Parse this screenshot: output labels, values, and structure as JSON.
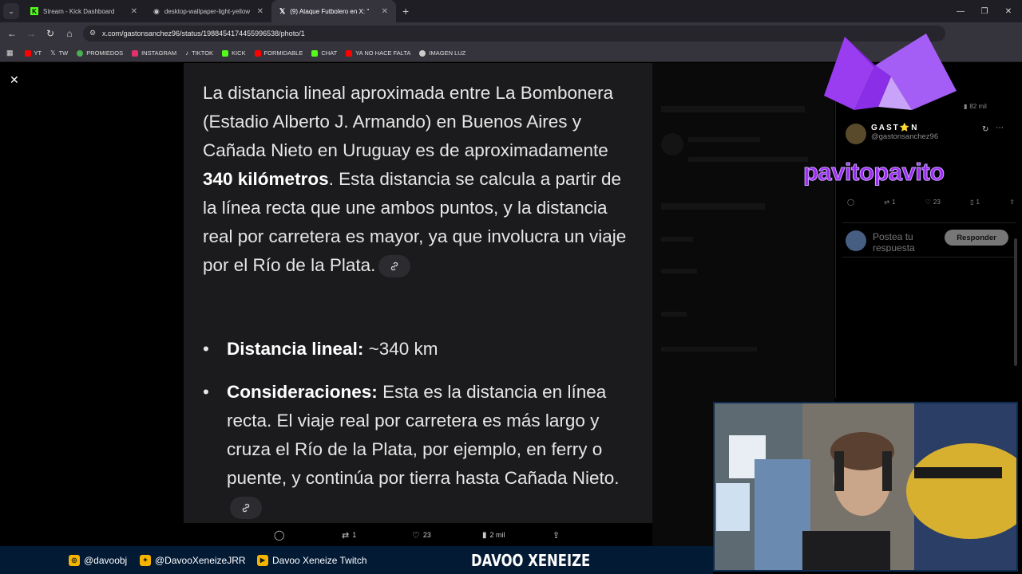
{
  "browser": {
    "tabs": [
      {
        "label": "Stream - Kick Dashboard",
        "icon": "kick-icon"
      },
      {
        "label": "desktop-wallpaper-light-yellow",
        "icon": "globe-icon"
      },
      {
        "label": "(9) Ataque Futbolero en X: \"",
        "icon": "x-icon",
        "active": true
      }
    ],
    "url": "x.com/gastonsanchez96/status/1988454174455996538/photo/1",
    "bookmarks": [
      {
        "label": "YT",
        "color": "#ff0000"
      },
      {
        "label": "TW",
        "color": "#ffffff"
      },
      {
        "label": "PROMIEDOS",
        "color": "#4caf50"
      },
      {
        "label": "INSTAGRAM",
        "color": "#e1306c"
      },
      {
        "label": "TIKTOK",
        "color": "#ffffff"
      },
      {
        "label": "KICK",
        "color": "#53fc18"
      },
      {
        "label": "FORMIDABLE",
        "color": "#ff0000"
      },
      {
        "label": "CHAT",
        "color": "#53fc18"
      },
      {
        "label": "YA NO HACE FALTA",
        "color": "#ff0000"
      },
      {
        "label": "IMAGEN LUZ",
        "color": "#cccccc"
      }
    ]
  },
  "photo": {
    "para_1": "La distancia lineal aproximada entre La Bombonera (Estadio Alberto J. Armando) en Buenos Aires y Cañada Nieto en Uruguay es de aproximadamente ",
    "para_bold": "340 kilómetros",
    "para_2": ". Esta distancia se calcula a partir de la línea recta que une ambos puntos, y la distancia real por carretera es mayor, ya que involucra un viaje por el Río de la Plata.",
    "bullet_1_label": "Distancia lineal:",
    "bullet_1_text": " ~340 km",
    "bullet_2_label": "Consideraciones:",
    "bullet_2_text": " Esta es la distancia en línea recta. El viaje real por carretera es más largo y cruza el Río de la Plata, por ejemplo, en ferry o puente, y continúa por tierra hasta Cañada Nieto."
  },
  "photo_actions": {
    "retweets": "1",
    "likes": "23",
    "views": "2 mil"
  },
  "tweet": {
    "author_name": "GAST⭐N",
    "author_handle": "@gastonsanchez96",
    "views": "82 mil",
    "retweets": "1",
    "likes": "23",
    "bookmarks": "1",
    "reply_placeholder": "Postea tu respuesta",
    "reply_button": "Responder"
  },
  "overlay": {
    "channel_name": "pavitopavito"
  },
  "stream_bar": {
    "instagram": "@davoobj",
    "twitter": "@DavooXeneizeJRR",
    "youtube": "Davoo Xeneize Twitch",
    "brand": "DAVOO XENEIZE"
  },
  "colors": {
    "accent_purple": "#9d2cf0",
    "stream_bar_bg": "#031a35"
  }
}
